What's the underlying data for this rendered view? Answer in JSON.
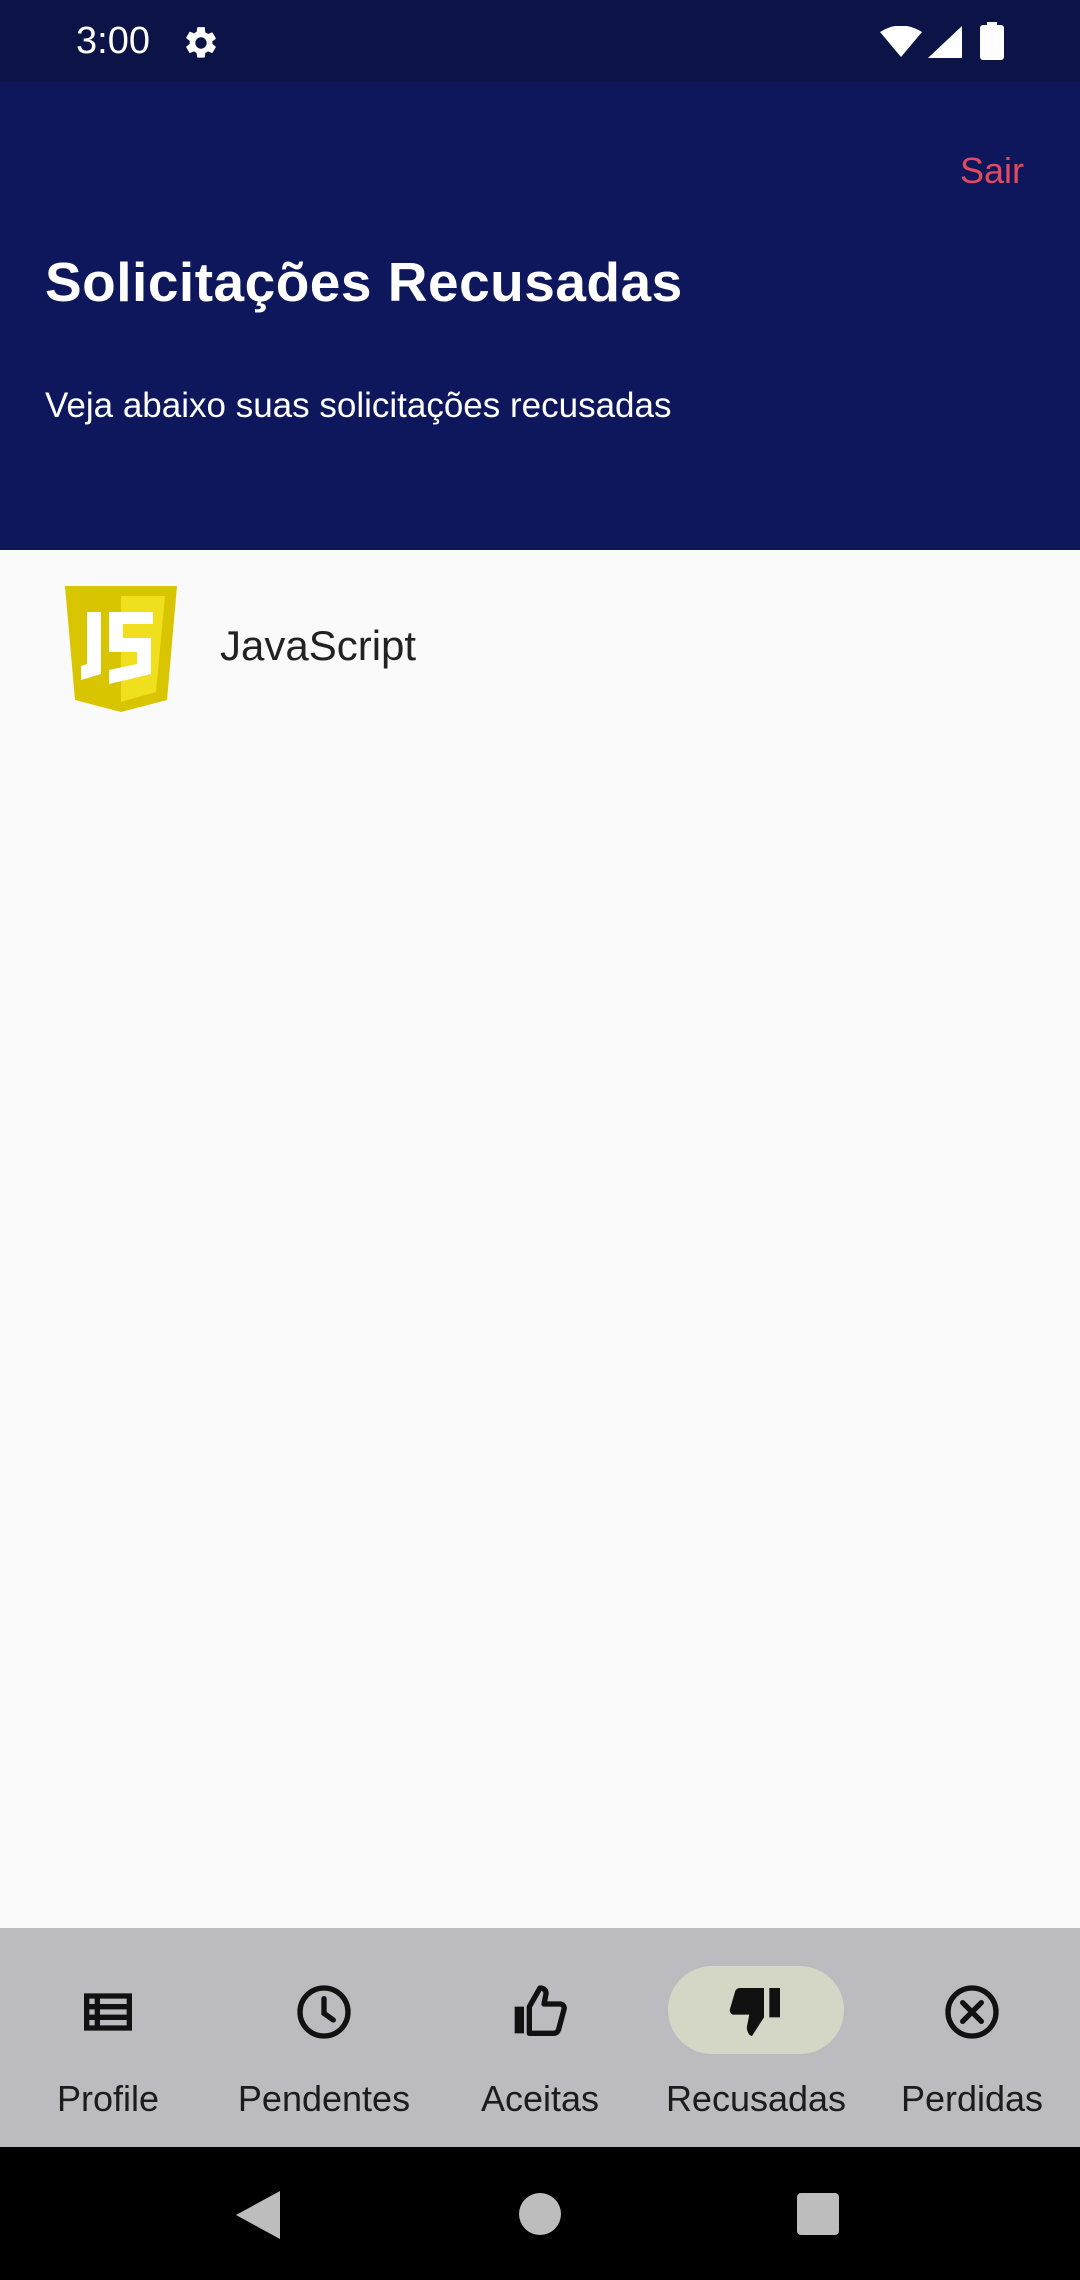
{
  "status_bar": {
    "time": "3:00",
    "icons": [
      "gear-icon",
      "wifi-icon",
      "signal-icon",
      "battery-icon"
    ]
  },
  "header": {
    "logout_label": "Sair",
    "title": "Solicitações Recusadas",
    "subtitle": "Veja abaixo suas solicitações recusadas",
    "background_color": "#0e175c",
    "logout_color": "#e34a5e"
  },
  "list": {
    "items": [
      {
        "label": "JavaScript",
        "icon": "javascript-logo-icon"
      }
    ]
  },
  "bottom_nav": {
    "active": "Recusadas",
    "items": [
      {
        "label": "Profile",
        "icon": "list-icon"
      },
      {
        "label": "Pendentes",
        "icon": "clock-icon"
      },
      {
        "label": "Aceitas",
        "icon": "thumbs-up-icon"
      },
      {
        "label": "Recusadas",
        "icon": "thumbs-down-icon"
      },
      {
        "label": "Perdidas",
        "icon": "cancel-circle-icon"
      }
    ]
  },
  "system_nav": {
    "icons": [
      "back-icon",
      "home-icon",
      "recents-icon"
    ]
  }
}
